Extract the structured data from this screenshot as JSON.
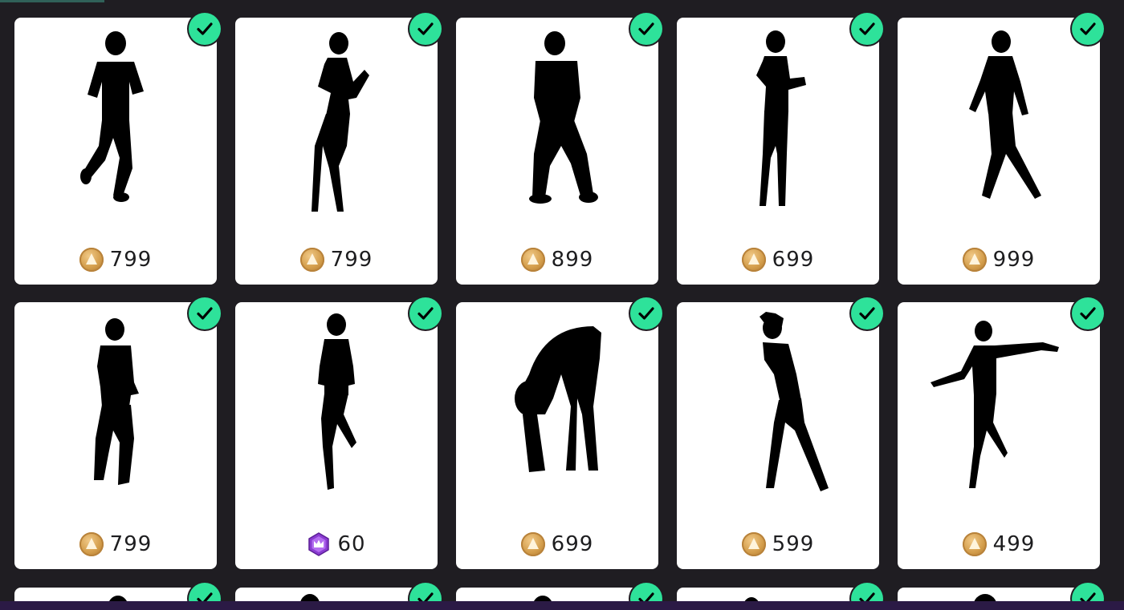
{
  "colors": {
    "background": "#1f1d22",
    "card": "#ffffff",
    "owned_check": "#2ee29a",
    "coin_gold": "#d39d4b",
    "gem_purple": "#8a3bd1",
    "bottom_bar": "#2b1a45"
  },
  "rows": [
    {
      "cards": [
        {
          "price": "799",
          "currency_icon": "coin-icon",
          "owned": true
        },
        {
          "price": "799",
          "currency_icon": "coin-icon",
          "owned": true
        },
        {
          "price": "899",
          "currency_icon": "coin-icon",
          "owned": true
        },
        {
          "price": "699",
          "currency_icon": "coin-icon",
          "owned": true
        },
        {
          "price": "999",
          "currency_icon": "coin-icon",
          "owned": true
        }
      ]
    },
    {
      "cards": [
        {
          "price": "799",
          "currency_icon": "coin-icon",
          "owned": true
        },
        {
          "price": "60",
          "currency_icon": "crown-gem-icon",
          "owned": true
        },
        {
          "price": "699",
          "currency_icon": "coin-icon",
          "owned": true
        },
        {
          "price": "599",
          "currency_icon": "coin-icon",
          "owned": true
        },
        {
          "price": "499",
          "currency_icon": "coin-icon",
          "owned": true
        }
      ]
    }
  ],
  "partial_row": {
    "cards": [
      {
        "owned": true
      },
      {
        "owned": true
      },
      {
        "owned": true
      },
      {
        "owned": true
      },
      {
        "owned": true
      }
    ]
  }
}
